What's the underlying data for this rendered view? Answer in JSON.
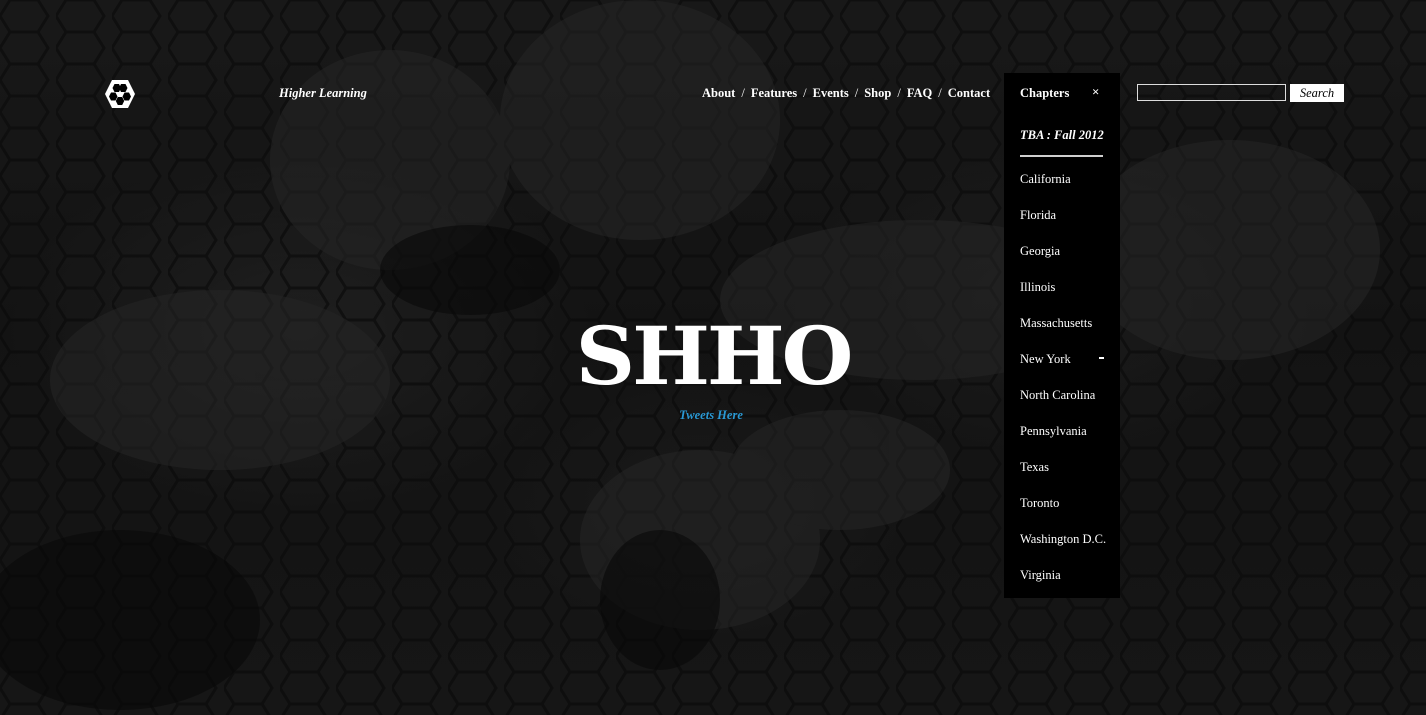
{
  "header": {
    "tagline": "Higher Learning"
  },
  "nav": {
    "items": [
      "About",
      "Features",
      "Events",
      "Shop",
      "FAQ",
      "Contact"
    ],
    "separator": "/"
  },
  "chapters": {
    "title": "Chapters",
    "close_icon": "×",
    "featured": "TBA : Fall 2012",
    "items": [
      "California",
      "Florida",
      "Georgia",
      "Illinois",
      "Massachusetts",
      "New York",
      "North Carolina",
      "Pennsylvania",
      "Texas",
      "Toronto",
      "Washington D.C.",
      "Virginia"
    ],
    "expanded_item": "New York"
  },
  "search": {
    "value": "",
    "button_label": "Search"
  },
  "hero": {
    "title": "SHHO",
    "tweets_link": "Tweets Here"
  },
  "colors": {
    "accent_link": "#2a9ad6",
    "panel": "#000000",
    "text": "#ffffff"
  },
  "icons": {
    "logo": "hexagon-cluster-logo-icon",
    "close": "close-icon",
    "collapse": "minus-icon"
  }
}
